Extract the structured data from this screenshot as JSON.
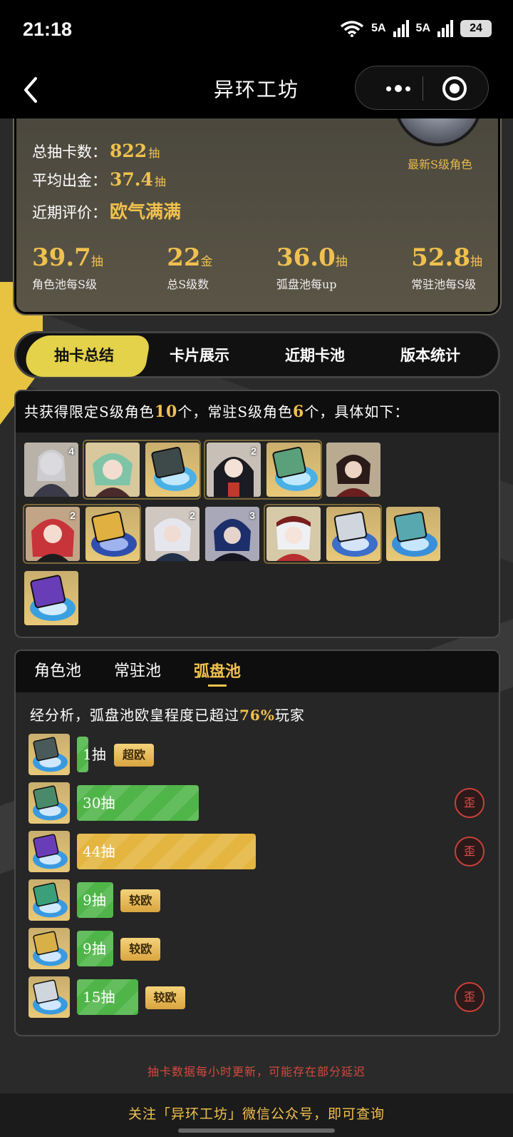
{
  "status": {
    "time": "21:18",
    "sig1": "5A",
    "sig2": "5A",
    "battery": "24"
  },
  "nav": {
    "title": "异环工坊"
  },
  "summary": {
    "total_label": "总抽卡数：",
    "total_value": "822",
    "total_unit": "抽",
    "avg_label": "平均出金：",
    "avg_value": "37.4",
    "avg_unit": "抽",
    "rating_label": "近期评价：",
    "rating_value": "欧气满满",
    "avatar_caption": "最新S级角色",
    "stats": [
      {
        "value": "39.7",
        "unit": "抽",
        "label": "角色池每S级"
      },
      {
        "value": "22",
        "unit": "金",
        "label": "总S级数"
      },
      {
        "value": "36.0",
        "unit": "抽",
        "label": "弧盘池每up"
      },
      {
        "value": "52.8",
        "unit": "抽",
        "label": "常驻池每S级"
      }
    ]
  },
  "tabs": [
    "抽卡总结",
    "卡片展示",
    "近期卡池",
    "版本统计"
  ],
  "chars": {
    "head_pre": "共获得限定S级角色",
    "limited_count": "10",
    "head_mid": "个，常驻S级角色",
    "standard_count": "6",
    "head_post": "个，具体如下：",
    "tiles": [
      {
        "count": "4"
      },
      {
        "count": ""
      },
      {
        "count": ""
      },
      {
        "count": "2"
      },
      {
        "count": ""
      },
      {
        "count": ""
      },
      {
        "count": "2"
      },
      {
        "count": ""
      },
      {
        "count": "2"
      },
      {
        "count": "3"
      },
      {
        "count": ""
      },
      {
        "count": ""
      },
      {
        "count": ""
      },
      {
        "count": ""
      }
    ]
  },
  "pool": {
    "tabs": [
      "角色池",
      "常驻池",
      "弧盘池"
    ],
    "note_pre": "经分析，弧盘池欧皇程度已超过",
    "note_pct": "76%",
    "note_post": "玩家",
    "rows": [
      {
        "label": "1抽",
        "pulls": 1,
        "tag": "超欧",
        "wai": ""
      },
      {
        "label": "30抽",
        "pulls": 30,
        "tag": "",
        "wai": "歪"
      },
      {
        "label": "44抽",
        "pulls": 44,
        "tag": "",
        "wai": "歪"
      },
      {
        "label": "9抽",
        "pulls": 9,
        "tag": "较欧",
        "wai": ""
      },
      {
        "label": "9抽",
        "pulls": 9,
        "tag": "较欧",
        "wai": ""
      },
      {
        "label": "15抽",
        "pulls": 15,
        "tag": "较欧",
        "wai": "歪"
      }
    ],
    "colors": {
      "green": "#4fb548",
      "gold": "#e4b53f"
    }
  },
  "footer": {
    "note": "抽卡数据每小时更新，可能存在部分延迟",
    "follow": "关注「异环工坊」微信公众号，即可查询"
  }
}
